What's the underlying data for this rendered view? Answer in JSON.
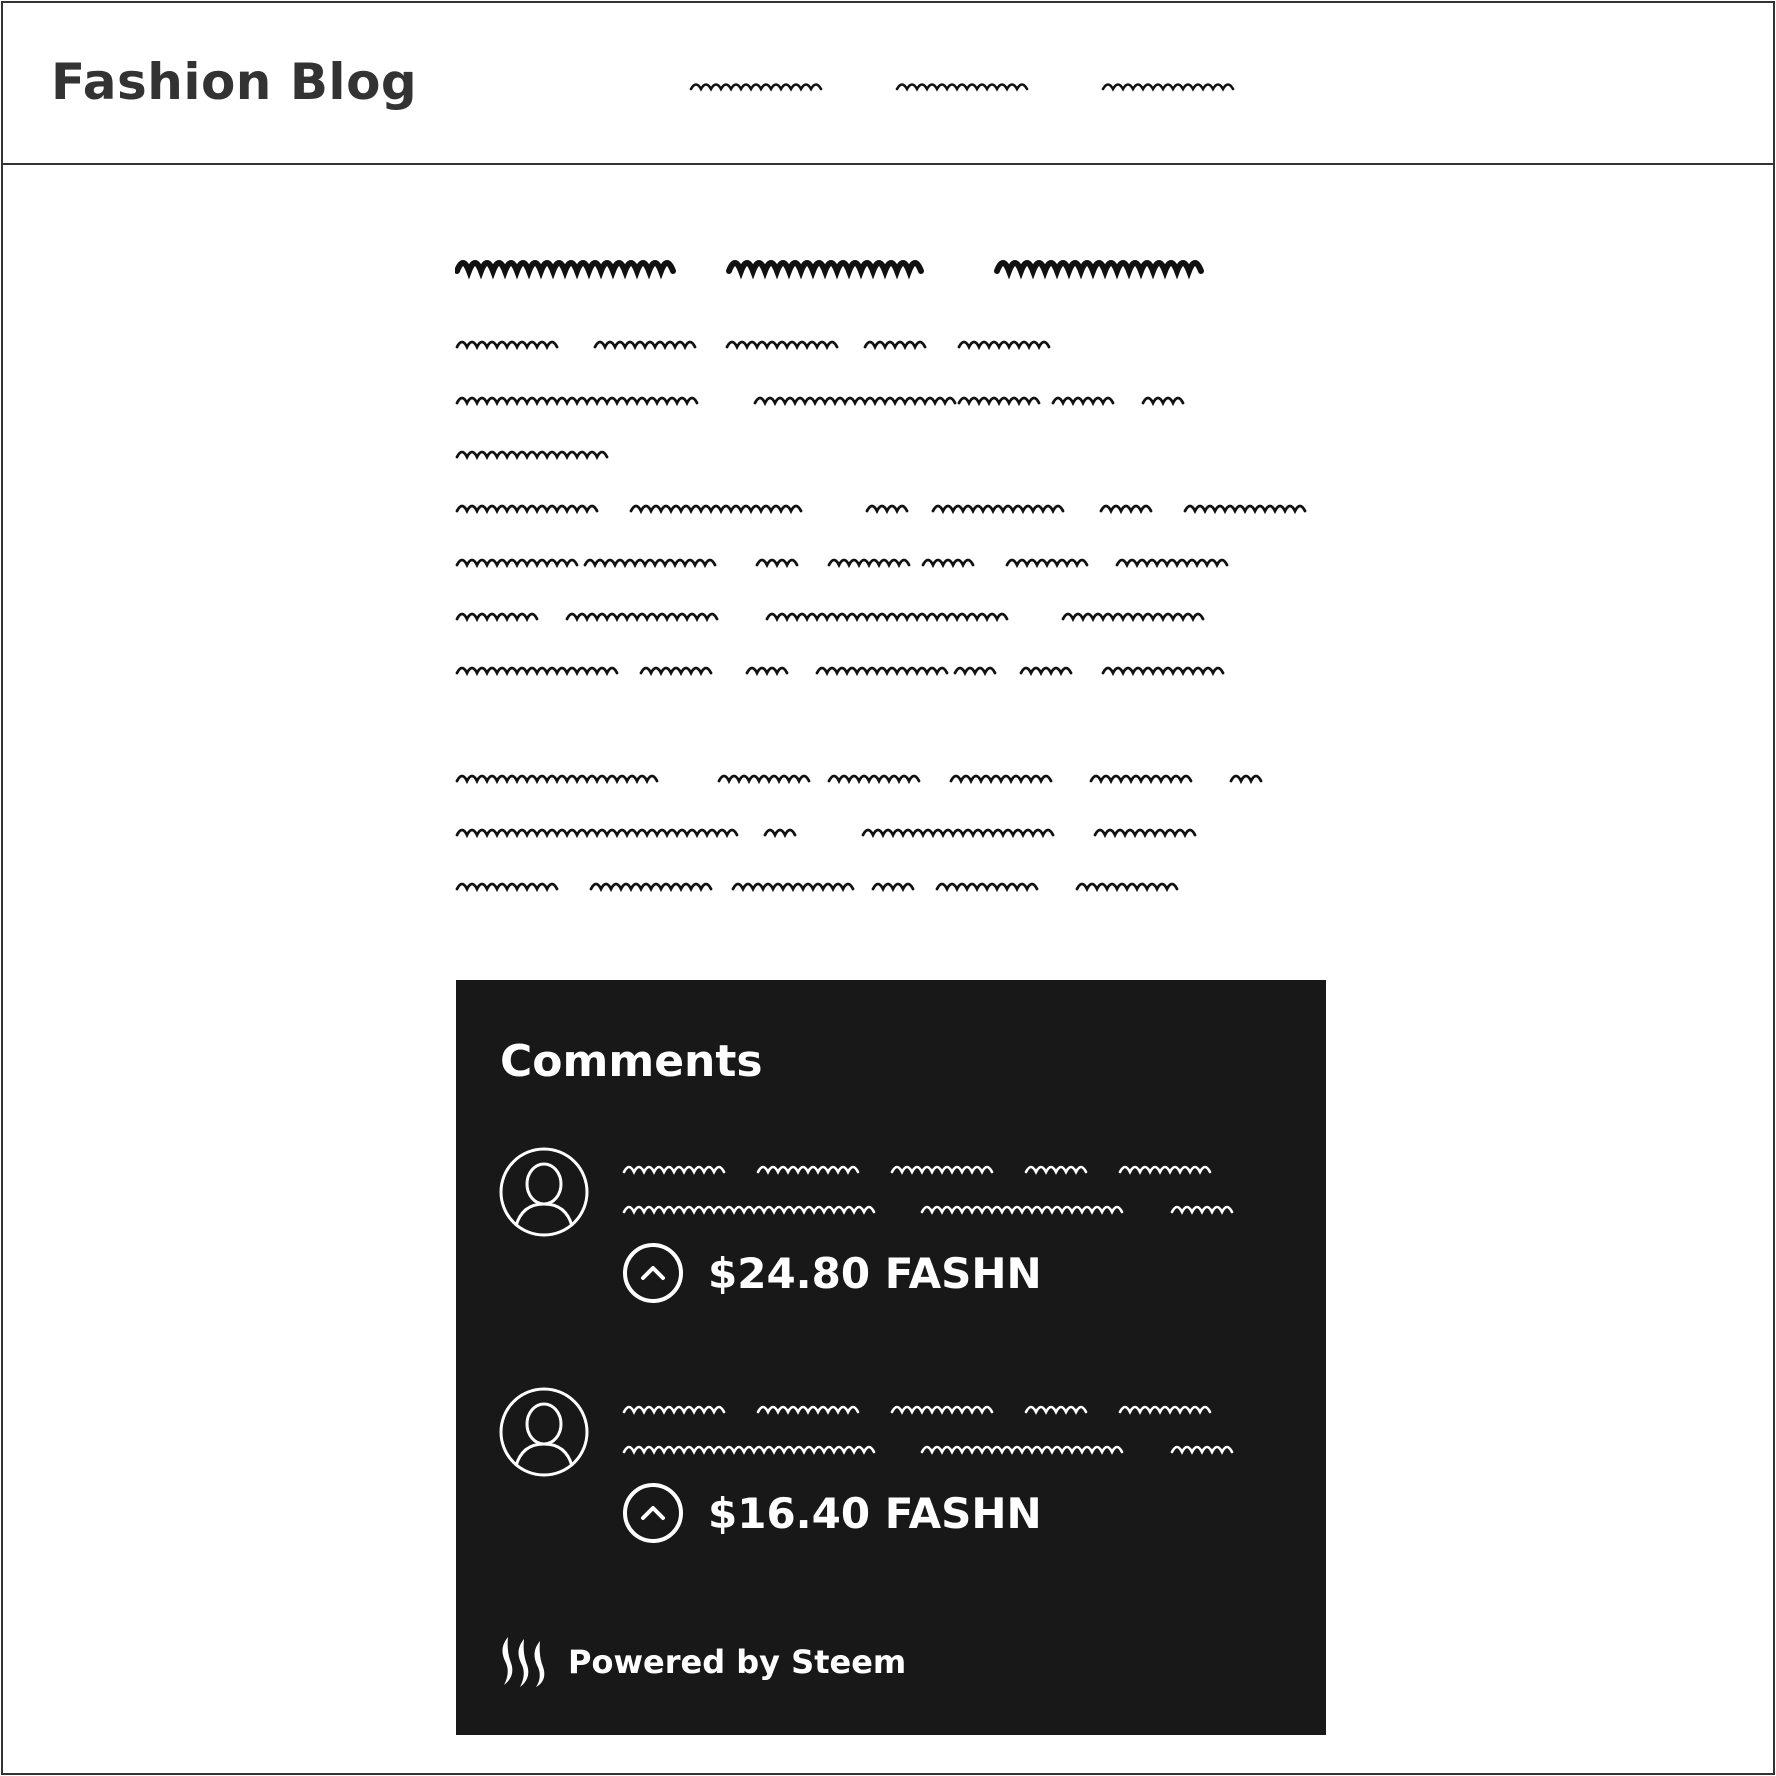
{
  "header": {
    "brand": "Fashion Blog",
    "nav_items": [
      "nav-link-1",
      "nav-link-2",
      "nav-link-3"
    ]
  },
  "comments": {
    "title": "Comments",
    "items": [
      {
        "avatar_icon": "user-avatar-icon",
        "upvote_icon": "upvote-icon",
        "payout": "$24.80 FASHN"
      },
      {
        "avatar_icon": "user-avatar-icon",
        "upvote_icon": "upvote-icon",
        "payout": "$16.40 FASHN"
      }
    ],
    "footer": {
      "logo_icon": "steem-logo-icon",
      "label": "Powered by Steem"
    }
  },
  "colors": {
    "frame": "#333333",
    "panel_bg": "#181818",
    "text_light": "#ffffff",
    "squiggle": "#111111"
  }
}
